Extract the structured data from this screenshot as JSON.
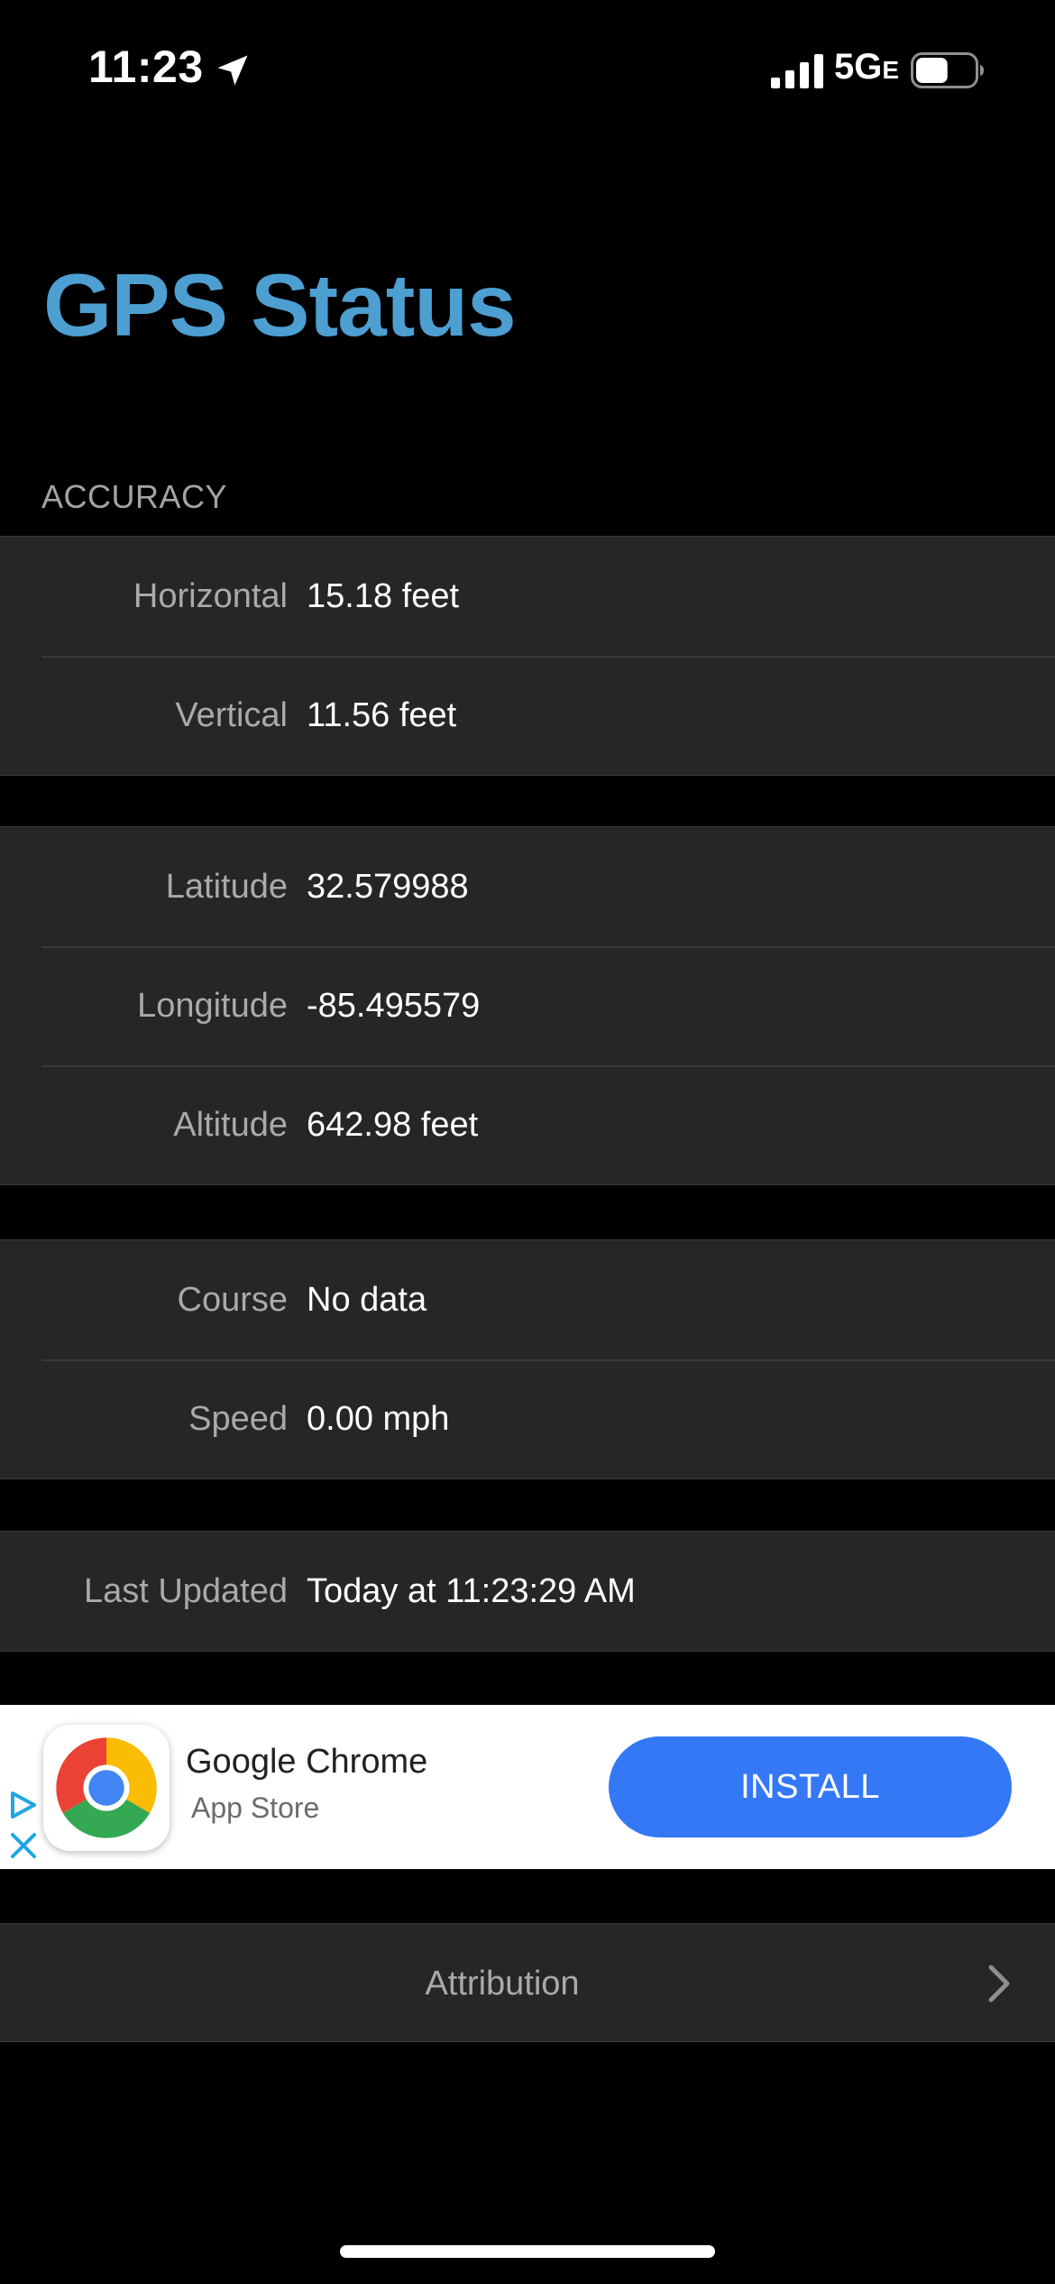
{
  "status_bar": {
    "time": "11:23",
    "network": "5G",
    "network_suffix": "E",
    "icons": [
      "location-arrow-icon",
      "cellular-signal-icon",
      "battery-icon"
    ],
    "battery_level": 0.55
  },
  "page_title": "GPS Status",
  "accuracy_section": {
    "header": "ACCURACY",
    "rows": [
      {
        "label": "Horizontal",
        "value": "15.18 feet"
      },
      {
        "label": "Vertical",
        "value": "11.56 feet"
      }
    ]
  },
  "position_section": {
    "rows": [
      {
        "label": "Latitude",
        "value": "32.579988"
      },
      {
        "label": "Longitude",
        "value": "-85.495579"
      },
      {
        "label": "Altitude",
        "value": "642.98 feet"
      }
    ]
  },
  "motion_section": {
    "rows": [
      {
        "label": "Course",
        "value": "No data"
      },
      {
        "label": "Speed",
        "value": "0.00 mph"
      }
    ]
  },
  "update_section": {
    "rows": [
      {
        "label": "Last Updated",
        "value": "Today at 11:23:29 AM"
      }
    ]
  },
  "ad": {
    "app_name": "Google Chrome",
    "store": "App Store",
    "button_label": "INSTALL",
    "icons": [
      "ad-choices-icon",
      "close-icon",
      "chrome-logo-icon"
    ],
    "colors": {
      "button": "#3478f6",
      "background": "#ffffff"
    }
  },
  "attribution": {
    "label": "Attribution",
    "icon": "chevron-right-icon"
  },
  "colors": {
    "title": "#4d9fd1",
    "background": "#000000",
    "cell_background": "#262626",
    "label": "#a9a9ae",
    "value": "#ffffff"
  }
}
